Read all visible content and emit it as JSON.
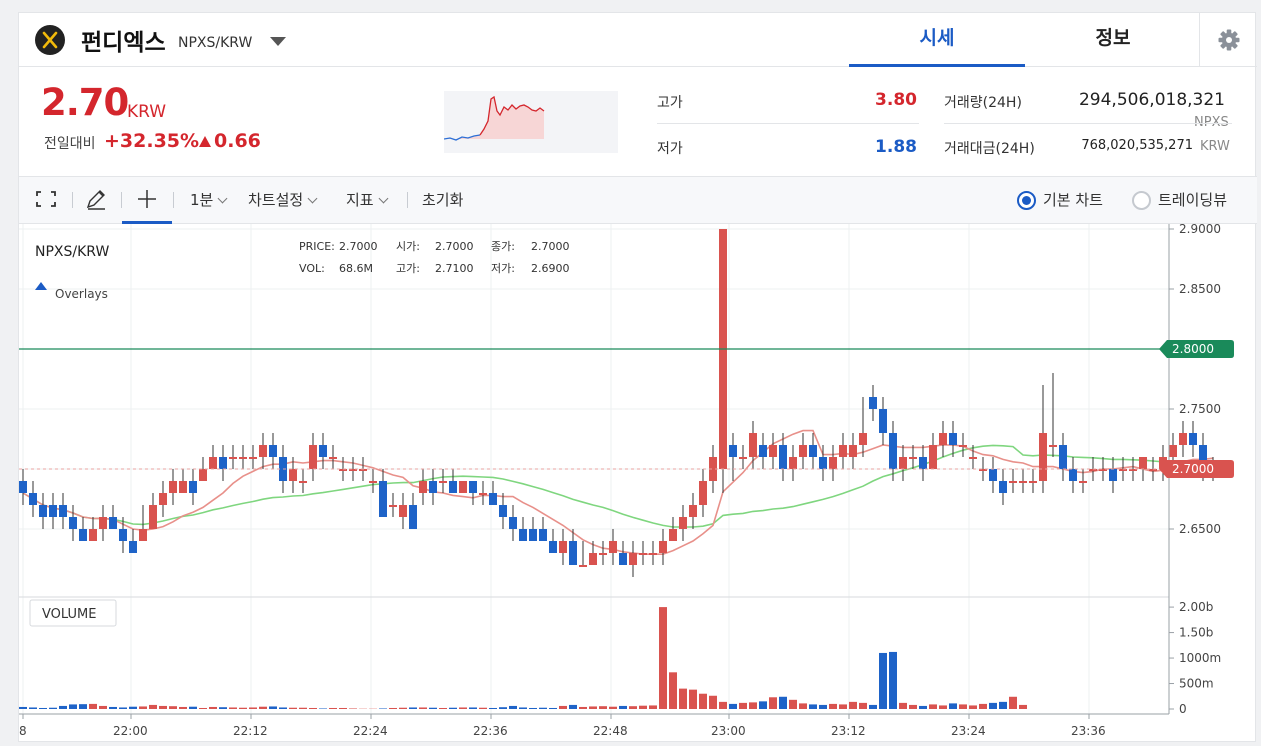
{
  "header": {
    "coin_name": "펀디엑스",
    "pair": "NPXS/KRW",
    "tabs": [
      {
        "label": "시세",
        "active": true
      },
      {
        "label": "정보",
        "active": false
      }
    ]
  },
  "price": {
    "current": "2.70",
    "unit": "KRW",
    "change_label": "전일대비",
    "change_pct": "+32.35%",
    "change_abs": "0.66",
    "direction": "up"
  },
  "stats": {
    "high_label": "고가",
    "high": "3.80",
    "low_label": "저가",
    "low": "1.88",
    "volume_label": "거래량(24H)",
    "volume": "294,506,018,321",
    "volume_unit": "NPXS",
    "value_label": "거래대금(24H)",
    "value": "768,020,535,271",
    "value_unit": "KRW"
  },
  "toolbar": {
    "interval": "1분",
    "chart_settings": "차트설정",
    "indicators": "지표",
    "reset": "초기화",
    "view_basic": "기본 차트",
    "view_tradingview": "트레이딩뷰",
    "selected_view": "basic"
  },
  "chart": {
    "symbol": "NPXS/KRW",
    "overlays_label": "Overlays",
    "ohlc": {
      "price_label": "PRICE:",
      "price": "2.7000",
      "open_label": "시가:",
      "open": "2.7000",
      "close_label": "종가:",
      "close": "2.7000",
      "vol_label": "VOL:",
      "vol": "68.6M",
      "high_label": "고가:",
      "high": "2.7100",
      "low_label": "저가:",
      "low": "2.6900"
    },
    "volume_label": "VOLUME",
    "price_ticks": [
      "2.9000",
      "2.8500",
      "2.7500",
      "2.6500"
    ],
    "price_tick_values": [
      2.9,
      2.85,
      2.75,
      2.65
    ],
    "volume_ticks": [
      "2.00b",
      "1.50b",
      "1000m",
      "500m",
      "0"
    ],
    "volume_tick_values": [
      2000,
      1500,
      1000,
      500,
      0
    ],
    "time_ticks": [
      "8",
      "22:00",
      "22:12",
      "22:24",
      "22:36",
      "22:48",
      "23:00",
      "23:12",
      "23:24",
      "23:36"
    ],
    "high_line_label": "2.8000",
    "high_line_value": 2.8,
    "last_price_label": "2.7000",
    "last_price_value": 2.7,
    "colors": {
      "up": "#d9534f",
      "down": "#1e63c8",
      "ma_short": "#e8908a",
      "ma_long": "#7fd67f",
      "high_line": "#1a8a5a"
    }
  },
  "chart_data": {
    "type": "candlestick",
    "xlabel": "",
    "ylabel": "",
    "ylim": [
      2.6,
      2.9
    ],
    "volume_ylim": [
      0,
      2100
    ],
    "candles": [
      [
        2.69,
        2.68,
        2.7,
        2.67
      ],
      [
        2.68,
        2.67,
        2.69,
        2.66
      ],
      [
        2.67,
        2.66,
        2.68,
        2.65
      ],
      [
        2.67,
        2.66,
        2.68,
        2.65
      ],
      [
        2.67,
        2.66,
        2.68,
        2.65
      ],
      [
        2.66,
        2.65,
        2.67,
        2.64
      ],
      [
        2.65,
        2.64,
        2.66,
        2.64
      ],
      [
        2.64,
        2.65,
        2.66,
        2.64
      ],
      [
        2.65,
        2.66,
        2.67,
        2.64
      ],
      [
        2.66,
        2.65,
        2.67,
        2.65
      ],
      [
        2.65,
        2.64,
        2.66,
        2.63
      ],
      [
        2.64,
        2.63,
        2.65,
        2.63
      ],
      [
        2.64,
        2.65,
        2.67,
        2.64
      ],
      [
        2.65,
        2.67,
        2.68,
        2.65
      ],
      [
        2.67,
        2.68,
        2.69,
        2.66
      ],
      [
        2.68,
        2.69,
        2.7,
        2.67
      ],
      [
        2.68,
        2.69,
        2.7,
        2.68
      ],
      [
        2.69,
        2.68,
        2.7,
        2.67
      ],
      [
        2.69,
        2.7,
        2.71,
        2.69
      ],
      [
        2.7,
        2.71,
        2.72,
        2.7
      ],
      [
        2.71,
        2.7,
        2.72,
        2.69
      ],
      [
        2.71,
        2.71,
        2.72,
        2.7
      ],
      [
        2.71,
        2.71,
        2.72,
        2.7
      ],
      [
        2.71,
        2.71,
        2.72,
        2.7
      ],
      [
        2.71,
        2.72,
        2.73,
        2.7
      ],
      [
        2.72,
        2.71,
        2.73,
        2.7
      ],
      [
        2.71,
        2.69,
        2.72,
        2.68
      ],
      [
        2.69,
        2.7,
        2.71,
        2.68
      ],
      [
        2.69,
        2.69,
        2.7,
        2.68
      ],
      [
        2.7,
        2.72,
        2.73,
        2.69
      ],
      [
        2.72,
        2.71,
        2.73,
        2.7
      ],
      [
        2.71,
        2.71,
        2.72,
        2.7
      ],
      [
        2.7,
        2.7,
        2.71,
        2.69
      ],
      [
        2.7,
        2.7,
        2.71,
        2.69
      ],
      [
        2.7,
        2.7,
        2.71,
        2.69
      ],
      [
        2.69,
        2.69,
        2.7,
        2.68
      ],
      [
        2.69,
        2.66,
        2.7,
        2.66
      ],
      [
        2.67,
        2.67,
        2.68,
        2.66
      ],
      [
        2.66,
        2.67,
        2.68,
        2.65
      ],
      [
        2.67,
        2.65,
        2.68,
        2.65
      ],
      [
        2.68,
        2.69,
        2.7,
        2.67
      ],
      [
        2.69,
        2.68,
        2.7,
        2.67
      ],
      [
        2.69,
        2.69,
        2.7,
        2.68
      ],
      [
        2.69,
        2.68,
        2.7,
        2.68
      ],
      [
        2.68,
        2.69,
        2.69,
        2.68
      ],
      [
        2.69,
        2.68,
        2.69,
        2.67
      ],
      [
        2.68,
        2.68,
        2.69,
        2.67
      ],
      [
        2.68,
        2.67,
        2.69,
        2.67
      ],
      [
        2.67,
        2.66,
        2.68,
        2.65
      ],
      [
        2.66,
        2.65,
        2.67,
        2.64
      ],
      [
        2.65,
        2.64,
        2.66,
        2.64
      ],
      [
        2.65,
        2.64,
        2.66,
        2.64
      ],
      [
        2.65,
        2.64,
        2.66,
        2.64
      ],
      [
        2.64,
        2.63,
        2.65,
        2.63
      ],
      [
        2.63,
        2.64,
        2.65,
        2.62
      ],
      [
        2.64,
        2.62,
        2.65,
        2.62
      ],
      [
        2.62,
        2.62,
        2.64,
        2.62
      ],
      [
        2.62,
        2.63,
        2.64,
        2.62
      ],
      [
        2.63,
        2.63,
        2.64,
        2.62
      ],
      [
        2.63,
        2.64,
        2.65,
        2.62
      ],
      [
        2.63,
        2.62,
        2.64,
        2.62
      ],
      [
        2.62,
        2.63,
        2.64,
        2.61
      ],
      [
        2.63,
        2.63,
        2.64,
        2.62
      ],
      [
        2.63,
        2.63,
        2.64,
        2.62
      ],
      [
        2.63,
        2.64,
        2.65,
        2.62
      ],
      [
        2.64,
        2.65,
        2.66,
        2.64
      ],
      [
        2.65,
        2.66,
        2.67,
        2.64
      ],
      [
        2.66,
        2.67,
        2.68,
        2.65
      ],
      [
        2.67,
        2.69,
        2.7,
        2.66
      ],
      [
        2.69,
        2.71,
        2.72,
        2.68
      ],
      [
        2.7,
        2.9,
        2.9,
        2.68
      ],
      [
        2.72,
        2.71,
        2.73,
        2.69
      ],
      [
        2.71,
        2.71,
        2.72,
        2.7
      ],
      [
        2.71,
        2.73,
        2.74,
        2.7
      ],
      [
        2.72,
        2.71,
        2.73,
        2.7
      ],
      [
        2.71,
        2.72,
        2.73,
        2.7
      ],
      [
        2.72,
        2.7,
        2.73,
        2.69
      ],
      [
        2.7,
        2.71,
        2.72,
        2.69
      ],
      [
        2.71,
        2.72,
        2.73,
        2.7
      ],
      [
        2.72,
        2.71,
        2.73,
        2.7
      ],
      [
        2.71,
        2.7,
        2.72,
        2.69
      ],
      [
        2.7,
        2.71,
        2.72,
        2.69
      ],
      [
        2.71,
        2.72,
        2.73,
        2.7
      ],
      [
        2.71,
        2.72,
        2.73,
        2.7
      ],
      [
        2.72,
        2.73,
        2.76,
        2.71
      ],
      [
        2.76,
        2.75,
        2.77,
        2.74
      ],
      [
        2.75,
        2.73,
        2.76,
        2.72
      ],
      [
        2.73,
        2.7,
        2.74,
        2.69
      ],
      [
        2.7,
        2.71,
        2.72,
        2.69
      ],
      [
        2.71,
        2.71,
        2.72,
        2.7
      ],
      [
        2.71,
        2.7,
        2.72,
        2.69
      ],
      [
        2.7,
        2.72,
        2.73,
        2.7
      ],
      [
        2.72,
        2.73,
        2.74,
        2.71
      ],
      [
        2.73,
        2.72,
        2.74,
        2.71
      ],
      [
        2.72,
        2.72,
        2.73,
        2.71
      ],
      [
        2.71,
        2.71,
        2.72,
        2.7
      ],
      [
        2.7,
        2.7,
        2.71,
        2.69
      ],
      [
        2.7,
        2.69,
        2.71,
        2.68
      ],
      [
        2.69,
        2.68,
        2.7,
        2.67
      ],
      [
        2.69,
        2.69,
        2.7,
        2.68
      ],
      [
        2.69,
        2.69,
        2.7,
        2.68
      ],
      [
        2.69,
        2.69,
        2.7,
        2.68
      ],
      [
        2.69,
        2.73,
        2.77,
        2.68
      ],
      [
        2.72,
        2.72,
        2.78,
        2.71
      ],
      [
        2.72,
        2.7,
        2.73,
        2.69
      ],
      [
        2.7,
        2.69,
        2.71,
        2.68
      ],
      [
        2.69,
        2.69,
        2.7,
        2.68
      ],
      [
        2.7,
        2.7,
        2.71,
        2.69
      ],
      [
        2.7,
        2.7,
        2.71,
        2.69
      ],
      [
        2.7,
        2.69,
        2.71,
        2.68
      ],
      [
        2.7,
        2.7,
        2.71,
        2.69
      ],
      [
        2.7,
        2.7,
        2.71,
        2.69
      ],
      [
        2.7,
        2.71,
        2.71,
        2.69
      ],
      [
        2.7,
        2.7,
        2.71,
        2.69
      ],
      [
        2.7,
        2.71,
        2.72,
        2.69
      ],
      [
        2.71,
        2.72,
        2.73,
        2.7
      ],
      [
        2.72,
        2.73,
        2.74,
        2.71
      ],
      [
        2.73,
        2.72,
        2.74,
        2.71
      ],
      [
        2.72,
        2.7,
        2.73,
        2.69
      ],
      [
        2.7,
        2.7,
        2.71,
        2.69
      ]
    ],
    "volumes": [
      40,
      30,
      20,
      25,
      60,
      90,
      95,
      100,
      60,
      40,
      30,
      45,
      50,
      80,
      60,
      55,
      40,
      45,
      20,
      40,
      35,
      30,
      25,
      30,
      45,
      50,
      30,
      25,
      25,
      20,
      10,
      20,
      20,
      10,
      5,
      5,
      10,
      20,
      25,
      30,
      30,
      25,
      20,
      25,
      30,
      30,
      25,
      20,
      35,
      60,
      30,
      20,
      25,
      20,
      60,
      80,
      40,
      50,
      55,
      45,
      60,
      55,
      65,
      70,
      2000,
      720,
      400,
      380,
      300,
      260,
      140,
      100,
      120,
      130,
      150,
      230,
      240,
      180,
      110,
      90,
      80,
      100,
      90,
      140,
      120,
      80,
      1100,
      1120,
      120,
      80,
      60,
      90,
      70,
      110,
      90,
      70,
      100,
      120,
      140,
      240,
      80
    ]
  }
}
